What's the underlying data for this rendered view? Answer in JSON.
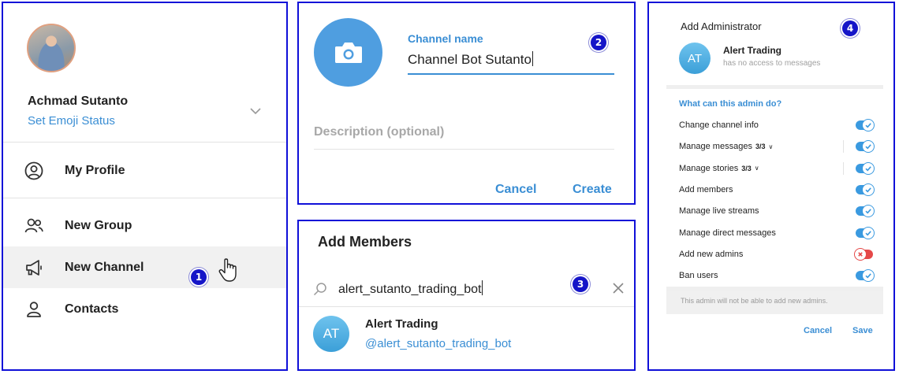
{
  "panel1": {
    "badge": "1",
    "user_name": "Achmad Sutanto",
    "status_link": "Set Emoji Status",
    "menu": [
      {
        "label": "My Profile",
        "icon": "profile-icon"
      },
      {
        "label": "New Group",
        "icon": "group-icon"
      },
      {
        "label": "New Channel",
        "icon": "megaphone-icon"
      },
      {
        "label": "Contacts",
        "icon": "contact-icon"
      }
    ]
  },
  "panel2": {
    "badge": "2",
    "field_label": "Channel name",
    "field_value": "Channel Bot Sutanto",
    "description_placeholder": "Description (optional)",
    "cancel_label": "Cancel",
    "create_label": "Create"
  },
  "panel3": {
    "badge": "3",
    "title": "Add Members",
    "search_value": "alert_sutanto_trading_bot",
    "result": {
      "initials": "AT",
      "name": "Alert Trading",
      "handle": "@alert_sutanto_trading_bot"
    }
  },
  "panel4": {
    "badge": "4",
    "title": "Add Administrator",
    "bot": {
      "initials": "AT",
      "name": "Alert Trading",
      "subtitle": "has no access to messages"
    },
    "question": "What can this admin do?",
    "permissions": [
      {
        "label": "Change channel info",
        "count": "",
        "enabled": true
      },
      {
        "label": "Manage messages",
        "count": "3/3",
        "enabled": true
      },
      {
        "label": "Manage stories",
        "count": "3/3",
        "enabled": true
      },
      {
        "label": "Add members",
        "count": "",
        "enabled": true
      },
      {
        "label": "Manage live streams",
        "count": "",
        "enabled": true
      },
      {
        "label": "Manage direct messages",
        "count": "",
        "enabled": true
      },
      {
        "label": "Add new admins",
        "count": "",
        "enabled": false
      },
      {
        "label": "Ban users",
        "count": "",
        "enabled": true
      }
    ],
    "note": "This admin will not be able to add new admins.",
    "cancel_label": "Cancel",
    "save_label": "Save"
  },
  "colors": {
    "accent": "#3a8ed4",
    "badge": "#1515c8",
    "panel_border": "#1010d8",
    "toggle_off": "#e54848"
  }
}
